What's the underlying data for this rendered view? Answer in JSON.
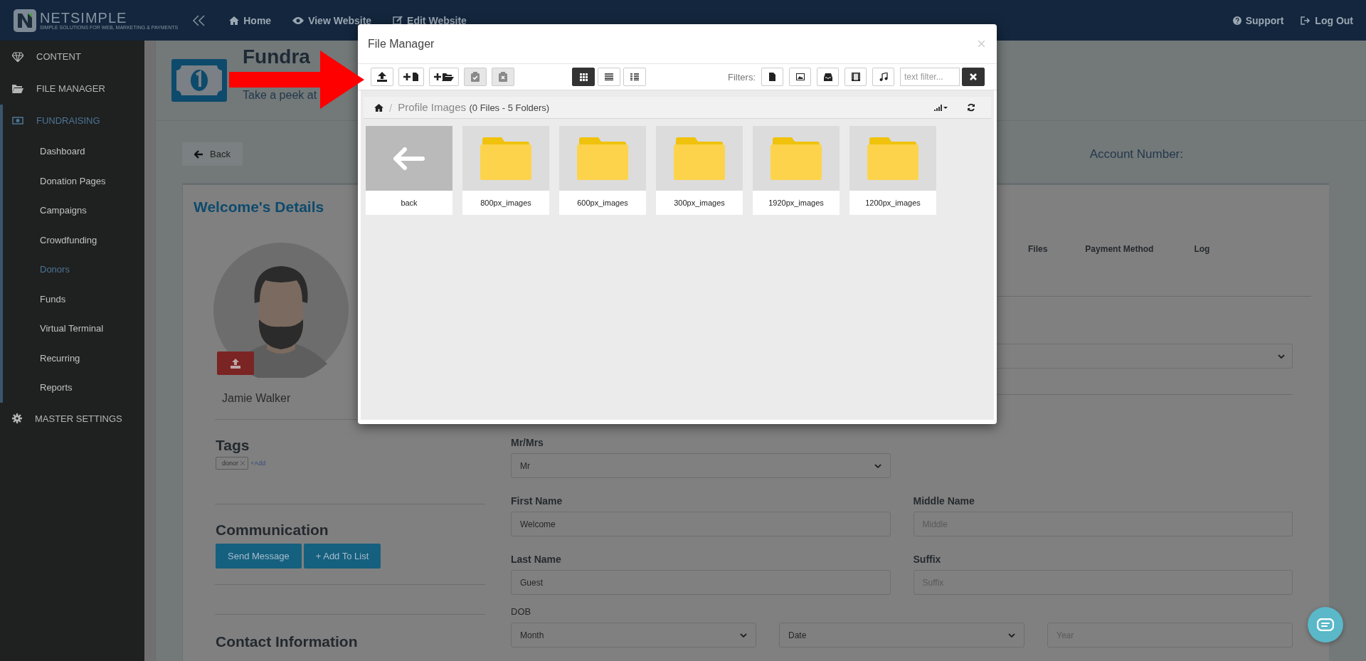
{
  "topbar": {
    "brand": "NETSIMPLE",
    "tagline": "SIMPLE SOLUTIONS FOR WEB, MARKETING & PAYMENTS",
    "nav": [
      {
        "label": "Home"
      },
      {
        "label": "View Website"
      },
      {
        "label": "Edit Website"
      }
    ],
    "right": [
      {
        "label": "Support"
      },
      {
        "label": "Log Out"
      }
    ]
  },
  "sidebar": {
    "items": [
      {
        "label": "CONTENT",
        "selected": false
      },
      {
        "label": "FILE MANAGER",
        "selected": false
      },
      {
        "label": "FUNDRAISING",
        "selected": true,
        "children": [
          {
            "label": "Dashboard",
            "selected": false
          },
          {
            "label": "Donation Pages",
            "selected": false
          },
          {
            "label": "Campaigns",
            "selected": false
          },
          {
            "label": "Crowdfunding",
            "selected": false
          },
          {
            "label": "Donors",
            "selected": true
          },
          {
            "label": "Funds",
            "selected": false
          },
          {
            "label": "Virtual Terminal",
            "selected": false
          },
          {
            "label": "Recurring",
            "selected": false
          },
          {
            "label": "Reports",
            "selected": false
          }
        ]
      },
      {
        "label": "MASTER SETTINGS",
        "selected": false
      }
    ]
  },
  "page_header": {
    "title": "Fundra",
    "subtitle": "Take a peek at"
  },
  "back_button": "Back",
  "account_label": "Account Number:",
  "donor": {
    "heading": "Welcome's Details",
    "name": "Jamie Walker",
    "tags_heading": "Tags",
    "tags": [
      "donor"
    ],
    "add_tag": "+Add",
    "communication_heading": "Communication",
    "buttons": [
      "Send Message",
      "+ Add To List"
    ],
    "contact_heading": "Contact Information"
  },
  "tabs": [
    {
      "label": "Files"
    },
    {
      "label": "Payment Method"
    },
    {
      "label": "Log"
    }
  ],
  "form": {
    "rows": [
      [
        {
          "label": "Mr/Mrs",
          "kind": "select",
          "value": "Mr"
        }
      ],
      [
        {
          "label": "First Name",
          "kind": "text",
          "value": "Welcome"
        },
        {
          "label": "Middle Name",
          "kind": "text",
          "placeholder": "Middle"
        }
      ],
      [
        {
          "label": "Last Name",
          "kind": "text",
          "value": "Guest"
        },
        {
          "label": "Suffix",
          "kind": "text",
          "placeholder": "Suffix"
        }
      ]
    ],
    "dob": {
      "label": "DOB",
      "parts": [
        {
          "kind": "select",
          "value": "Month"
        },
        {
          "kind": "select",
          "value": "Date"
        },
        {
          "kind": "text",
          "placeholder": "Year"
        }
      ]
    }
  },
  "file_manager": {
    "title": "File Manager",
    "views": [
      {
        "selected": true
      },
      {
        "selected": false
      },
      {
        "selected": false
      }
    ],
    "filters_label": "Filters:",
    "filter_placeholder": "text filter...",
    "breadcrumb": {
      "separator": "/",
      "folder": "Profile Images",
      "count": "(0 Files - 5 Folders)"
    },
    "items": [
      {
        "kind": "back",
        "name": "back"
      },
      {
        "kind": "folder",
        "name": "800px_images"
      },
      {
        "kind": "folder",
        "name": "600px_images"
      },
      {
        "kind": "folder",
        "name": "300px_images"
      },
      {
        "kind": "folder",
        "name": "1920px_images"
      },
      {
        "kind": "folder",
        "name": "1200px_images"
      }
    ]
  }
}
